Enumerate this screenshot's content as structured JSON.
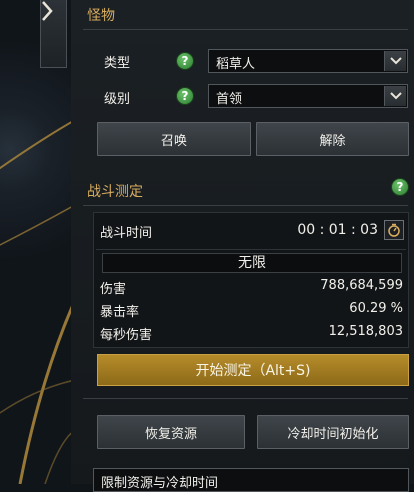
{
  "monster": {
    "title": "怪物",
    "type_label": "类型",
    "type_value": "稻草人",
    "level_label": "级别",
    "level_value": "首领",
    "summon_label": "召唤",
    "dismiss_label": "解除"
  },
  "battle": {
    "title": "战斗测定",
    "time_label": "战斗时间",
    "time_value": "00 : 01 : 03",
    "limit_value": "无限",
    "stats": [
      {
        "label": "伤害",
        "value": "788,684,599"
      },
      {
        "label": "暴击率",
        "value": "60.29 %"
      },
      {
        "label": "每秒伤害",
        "value": "12,518,803"
      }
    ],
    "start_label": "开始测定（Alt+S)"
  },
  "actions": {
    "restore_label": "恢复资源",
    "reset_cooldown_label": "冷却时间初始化",
    "limit_select_value": "限制资源与冷却时间"
  },
  "icons": {
    "help": "?",
    "collapse": "chevron-right-icon",
    "dropdown": "chevron-down-icon",
    "stopwatch": "stopwatch-icon"
  },
  "colors": {
    "section_title": "#d9ad5e",
    "help_green": "#3f9a3f",
    "start_button": "#a57c22"
  }
}
